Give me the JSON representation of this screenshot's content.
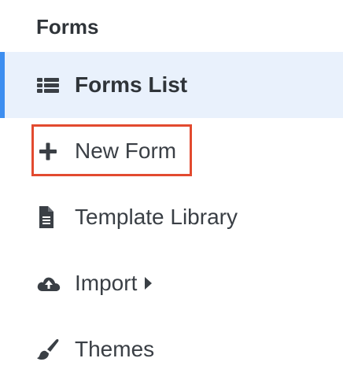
{
  "header": {
    "title": "Forms"
  },
  "menu": {
    "items": [
      {
        "label": "Forms List",
        "icon": "list-icon",
        "active": true
      },
      {
        "label": "New Form",
        "icon": "plus-icon",
        "active": false,
        "highlighted": true
      },
      {
        "label": "Template Library",
        "icon": "document-icon",
        "active": false
      },
      {
        "label": "Import",
        "icon": "cloud-upload-icon",
        "active": false,
        "has_submenu": true
      },
      {
        "label": "Themes",
        "icon": "brush-icon",
        "active": false
      }
    ]
  },
  "colors": {
    "active_background": "#e9f1fc",
    "active_indicator": "#3d8ef0",
    "highlight_border": "#e24a2f",
    "text": "#3a3f45",
    "icon": "#3a3f45"
  }
}
